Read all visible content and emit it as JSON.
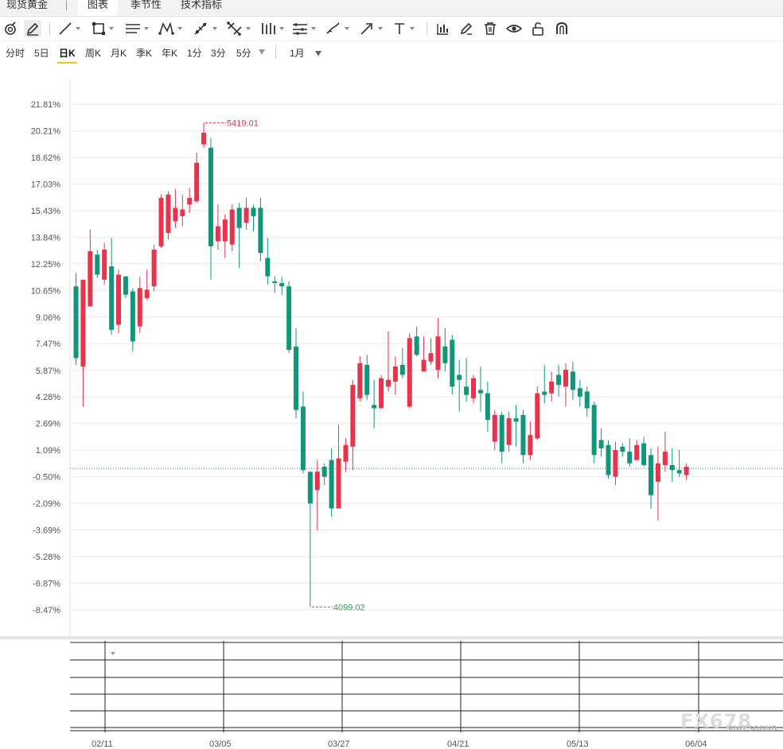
{
  "tabs": [
    {
      "label": "现货黄金"
    },
    {
      "label": "图表"
    },
    {
      "label": "季节性"
    },
    {
      "label": "技术指标"
    }
  ],
  "periods": [
    "分时",
    "5日",
    "日K",
    "周K",
    "月K",
    "季K",
    "年K",
    "1分",
    "3分",
    "5分"
  ],
  "active_period": "日K",
  "range": {
    "label": "1月"
  },
  "toolbar_icons": [
    "magnet-icon",
    "pencil-icon",
    "line-icon",
    "rectangle-icon",
    "parallel-lines-icon",
    "pattern-icon",
    "fibonacci-icon",
    "gann-icon",
    "bars-icon",
    "channel-icon",
    "brush-icon",
    "arrow-icon",
    "text-icon",
    "measure-icon",
    "edit-icon",
    "trash-icon",
    "eye-icon",
    "lock-icon",
    "magnet-u-icon"
  ],
  "chart_data": {
    "type": "candlestick",
    "y_ticks": [
      "21.81%",
      "20.21%",
      "18.62%",
      "17.03%",
      "15.43%",
      "13.84%",
      "12.25%",
      "10.65%",
      "9.06%",
      "7.47%",
      "5.87%",
      "4.28%",
      "2.69%",
      "1.09%",
      "-0.50%",
      "-2.09%",
      "-3.69%",
      "-5.28%",
      "-6.87%",
      "-8.47%"
    ],
    "x_labels": [
      "02/11",
      "03/05",
      "03/27",
      "04/21",
      "05/13",
      "06/04"
    ],
    "max_annotation": "5419.01",
    "min_annotation": "4099.02",
    "ylim": [
      -8.47,
      21.81
    ],
    "colors": {
      "up": "#e8334a",
      "down": "#12967a",
      "grid": "#e9e9e9",
      "baseline": "#12967a",
      "max_label": "#e8334a",
      "min_label": "#3a9a5b"
    },
    "candles": [
      [
        10.9,
        6.6,
        11.7,
        6.2
      ],
      [
        6.1,
        11.3,
        3.7,
        10.9
      ],
      [
        9.7,
        13.0,
        14.3,
        10.2
      ],
      [
        12.8,
        11.6,
        13.1,
        11.4
      ],
      [
        11.3,
        13.1,
        13.5,
        11.0
      ],
      [
        12.1,
        8.3,
        13.8,
        8.0
      ],
      [
        8.6,
        11.6,
        11.9,
        8.1
      ],
      [
        11.5,
        10.4,
        11.5,
        10.2
      ],
      [
        10.6,
        7.6,
        10.8,
        7.0
      ],
      [
        8.5,
        10.8,
        11.5,
        8.1
      ],
      [
        10.2,
        10.7,
        11.9,
        10.1
      ],
      [
        10.9,
        13.1,
        13.4,
        10.6
      ],
      [
        13.3,
        16.2,
        16.4,
        13.2
      ],
      [
        14.1,
        16.4,
        16.6,
        13.7
      ],
      [
        14.8,
        15.6,
        16.7,
        14.4
      ],
      [
        15.1,
        15.5,
        16.4,
        14.5
      ],
      [
        15.8,
        16.2,
        16.8,
        15.3
      ],
      [
        16.0,
        18.3,
        18.9,
        15.9
      ],
      [
        19.4,
        20.1,
        20.7,
        19.2
      ],
      [
        19.2,
        13.3,
        19.8,
        11.3
      ],
      [
        13.6,
        14.5,
        15.8,
        13.1
      ],
      [
        13.6,
        14.9,
        15.2,
        12.6
      ],
      [
        13.4,
        15.5,
        15.8,
        13.0
      ],
      [
        15.6,
        14.4,
        15.9,
        12.0
      ],
      [
        14.7,
        15.6,
        16.2,
        14.3
      ],
      [
        15.6,
        15.1,
        15.8,
        14.2
      ],
      [
        15.6,
        12.9,
        16.2,
        12.4
      ],
      [
        12.6,
        11.5,
        13.8,
        11.0
      ],
      [
        11.2,
        11.1,
        11.5,
        10.5
      ],
      [
        11.1,
        10.9,
        11.5,
        10.4
      ],
      [
        10.9,
        7.1,
        11.2,
        6.9
      ],
      [
        7.3,
        3.5,
        8.4,
        3.0
      ],
      [
        3.7,
        -0.1,
        4.6,
        -0.3
      ],
      [
        -0.2,
        -2.1,
        -1.8,
        -8.3
      ],
      [
        -1.3,
        -0.2,
        0.5,
        -3.7
      ],
      [
        0.1,
        -0.5,
        0.3,
        -1.0
      ],
      [
        0.5,
        -2.4,
        1.2,
        -2.9
      ],
      [
        -2.4,
        0.6,
        2.6,
        -2.3
      ],
      [
        0.4,
        1.4,
        1.8,
        -0.2
      ],
      [
        1.3,
        5.0,
        5.3,
        -0.1
      ],
      [
        4.2,
        6.3,
        6.7,
        4.0
      ],
      [
        6.2,
        4.4,
        6.8,
        4.1
      ],
      [
        3.8,
        3.6,
        5.3,
        2.4
      ],
      [
        3.6,
        5.4,
        5.6,
        3.6
      ],
      [
        4.9,
        5.3,
        8.2,
        4.6
      ],
      [
        5.2,
        6.1,
        6.7,
        4.4
      ],
      [
        6.2,
        5.6,
        7.2,
        5.4
      ],
      [
        3.7,
        7.8,
        8.1,
        3.6
      ],
      [
        7.9,
        6.8,
        8.5,
        6.7
      ],
      [
        5.8,
        6.5,
        7.9,
        5.9
      ],
      [
        6.4,
        6.9,
        7.8,
        6.2
      ],
      [
        5.9,
        7.9,
        9.0,
        5.4
      ],
      [
        7.3,
        6.3,
        8.4,
        5.8
      ],
      [
        7.7,
        4.9,
        8.0,
        4.4
      ],
      [
        5.6,
        5.3,
        6.5,
        3.4
      ],
      [
        4.9,
        4.4,
        6.6,
        4.0
      ],
      [
        4.2,
        5.4,
        5.6,
        3.9
      ],
      [
        4.7,
        4.5,
        6.1,
        3.4
      ],
      [
        4.5,
        2.9,
        5.2,
        2.2
      ],
      [
        1.6,
        3.2,
        3.5,
        1.1
      ],
      [
        3.2,
        1.0,
        3.4,
        0.3
      ],
      [
        1.4,
        3.0,
        3.4,
        1.0
      ],
      [
        3.0,
        2.8,
        3.8,
        1.3
      ],
      [
        3.2,
        0.8,
        3.5,
        0.3
      ],
      [
        0.8,
        2.0,
        2.8,
        0.5
      ],
      [
        1.8,
        4.5,
        4.9,
        1.7
      ],
      [
        4.6,
        4.4,
        6.2,
        3.9
      ],
      [
        4.5,
        5.2,
        5.8,
        4.0
      ],
      [
        5.6,
        5.0,
        6.2,
        4.3
      ],
      [
        4.9,
        5.9,
        6.3,
        3.7
      ],
      [
        5.8,
        4.7,
        6.4,
        4.1
      ],
      [
        4.8,
        4.3,
        5.3,
        3.7
      ],
      [
        4.6,
        3.6,
        4.9,
        3.1
      ],
      [
        3.8,
        0.8,
        4.0,
        0.3
      ],
      [
        1.7,
        1.2,
        2.4,
        0.7
      ],
      [
        1.4,
        -0.4,
        1.7,
        -0.6
      ],
      [
        -0.5,
        1.1,
        1.6,
        -1.0
      ],
      [
        1.3,
        1.0,
        1.5,
        0.7
      ],
      [
        1.0,
        0.3,
        1.8,
        0.1
      ],
      [
        0.5,
        1.4,
        1.7,
        0.7
      ],
      [
        1.5,
        0.2,
        1.9,
        0.1
      ],
      [
        0.8,
        -1.6,
        1.2,
        -2.4
      ],
      [
        -0.8,
        0.3,
        1.3,
        -3.1
      ],
      [
        0.2,
        1.0,
        2.2,
        -0.2
      ],
      [
        0.2,
        -0.1,
        1.2,
        -0.8
      ],
      [
        -0.1,
        -0.3,
        1.1,
        -0.5
      ],
      [
        -0.4,
        0.1,
        0.3,
        -0.7
      ]
    ],
    "last_value": "0.1"
  }
}
